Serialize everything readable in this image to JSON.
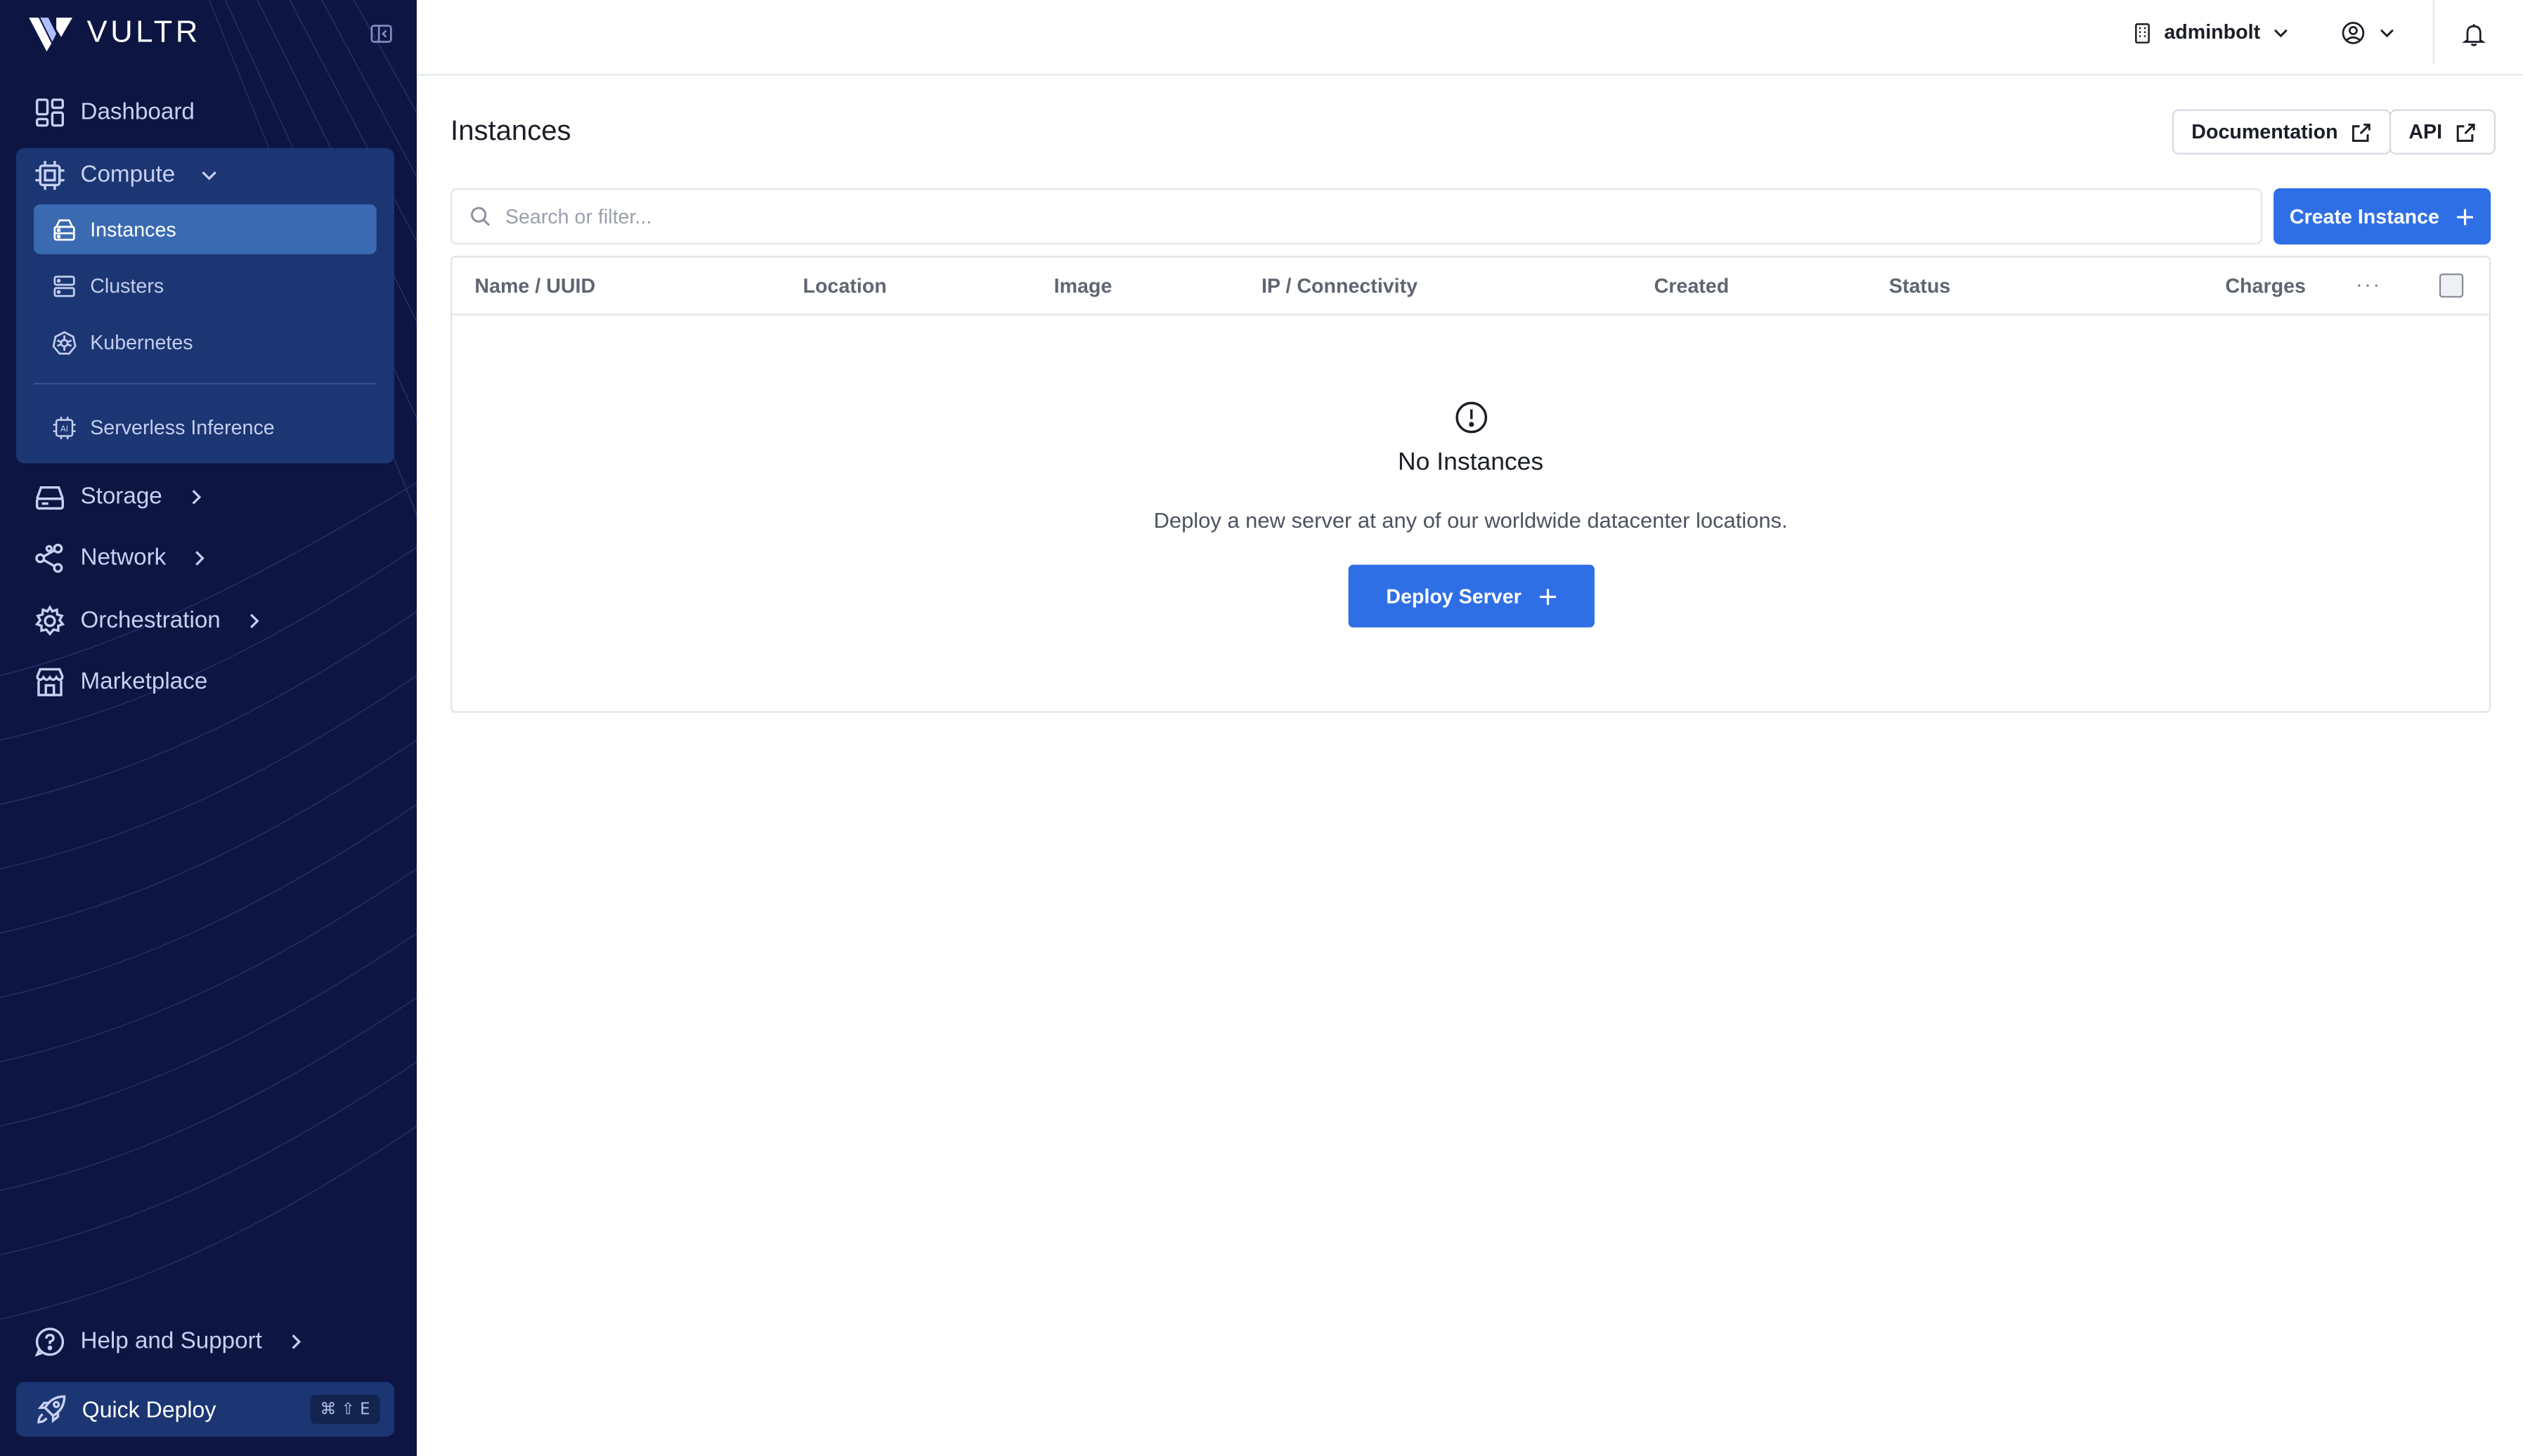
{
  "brand": {
    "name": "VULTR"
  },
  "sidebar": {
    "items": [
      {
        "label": "Dashboard",
        "icon": "dashboard-icon"
      },
      {
        "label": "Compute",
        "icon": "cpu-icon",
        "expanded": true
      },
      {
        "label": "Storage",
        "icon": "storage-icon"
      },
      {
        "label": "Network",
        "icon": "network-icon"
      },
      {
        "label": "Orchestration",
        "icon": "gear-icon"
      },
      {
        "label": "Marketplace",
        "icon": "store-icon"
      }
    ],
    "compute_sub": [
      {
        "label": "Instances",
        "icon": "server-icon",
        "active": true
      },
      {
        "label": "Clusters",
        "icon": "cluster-icon"
      },
      {
        "label": "Kubernetes",
        "icon": "kubernetes-icon"
      },
      {
        "label": "Serverless Inference",
        "icon": "ai-chip-icon"
      }
    ],
    "help": {
      "label": "Help and Support",
      "icon": "help-icon"
    },
    "quick_deploy": {
      "label": "Quick Deploy",
      "icon": "rocket-icon",
      "shortcut": "⌘ ⇧ E"
    }
  },
  "topbar": {
    "account": "adminbolt",
    "account_icon": "building-icon",
    "user_icon": "user-circle-icon",
    "bell_icon": "bell-icon"
  },
  "page": {
    "title": "Instances",
    "documentation_label": "Documentation",
    "api_label": "API",
    "search_placeholder": "Search or filter...",
    "create_label": "Create Instance"
  },
  "table": {
    "columns": [
      "Name / UUID",
      "Location",
      "Image",
      "IP / Connectivity",
      "Created",
      "Status",
      "Charges"
    ],
    "more": "···"
  },
  "empty": {
    "title": "No Instances",
    "description": "Deploy a new server at any of our worldwide datacenter locations.",
    "button": "Deploy Server"
  },
  "colors": {
    "sidebar_bg": "#0d1542",
    "sidebar_panel": "#1b3672",
    "active_item": "#3a6ab2",
    "primary": "#2f6fe6"
  }
}
